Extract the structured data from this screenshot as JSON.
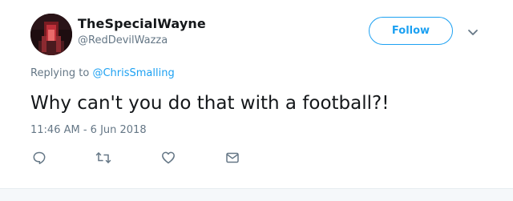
{
  "tweet": {
    "display_name": "TheSpecialWayne",
    "handle": "@RedDevilWazza",
    "follow_label": "Follow",
    "replying_prefix": "Replying to",
    "replying_to": "@ChrisSmalling",
    "text": "Why can't you do that with a football?!",
    "timestamp": "11:46 AM - 6 Jun 2018"
  },
  "icons": {
    "caret": "chevron-down-icon",
    "reply": "reply-icon",
    "retweet": "retweet-icon",
    "like": "heart-icon",
    "message": "envelope-icon"
  },
  "colors": {
    "accent": "#1da1f2",
    "text": "#14171a",
    "secondary": "#657786",
    "border": "#e6ecf0",
    "bottom_strip": "#f5f8fa"
  }
}
